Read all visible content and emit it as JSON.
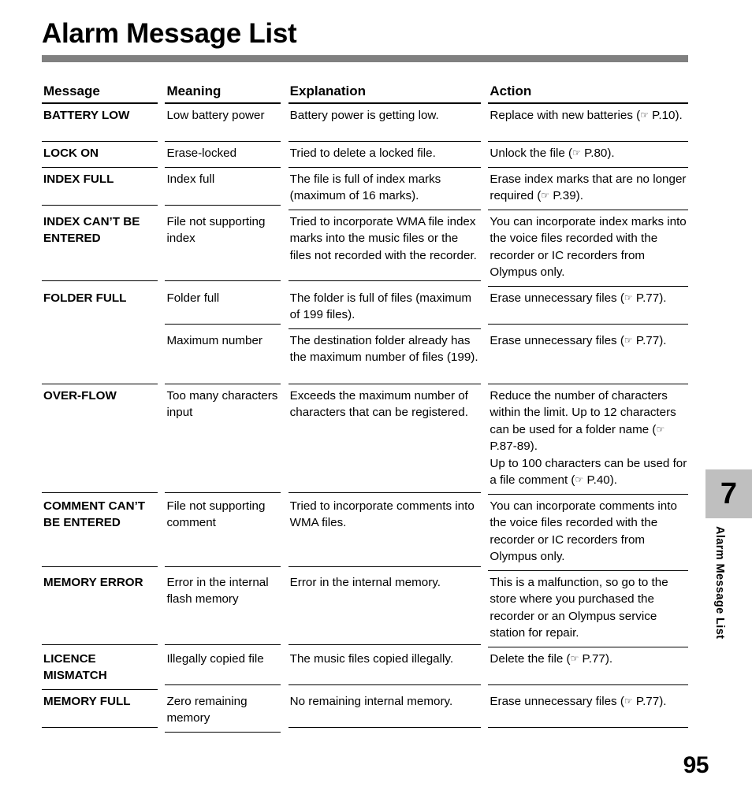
{
  "document": {
    "title": "Alarm Message List",
    "page_number": "95"
  },
  "chapter_tab": {
    "number": "7",
    "label": "Alarm Message List",
    "background_color": "#bfbfbf"
  },
  "table": {
    "headers": {
      "message": "Message",
      "meaning": "Meaning",
      "explanation": "Explanation",
      "action": "Action"
    },
    "ref_icon": "pointing-hand-icon",
    "ref_glyph": "☞",
    "rows": [
      {
        "message": "BATTERY LOW",
        "meaning": "Low battery power",
        "explanation": "Battery power is getting low.",
        "action_parts": [
          {
            "text": "Replace with new batteries ("
          },
          {
            "ref": true
          },
          {
            "text": " P.10)."
          }
        ]
      },
      {
        "message": "LOCK ON",
        "meaning": "Erase-locked",
        "explanation": "Tried to delete a locked file.",
        "action_parts": [
          {
            "text": "Unlock the file ("
          },
          {
            "ref": true
          },
          {
            "text": " P.80)."
          }
        ]
      },
      {
        "message": "INDEX FULL",
        "meaning": "Index full",
        "explanation": "The file is full of index marks (maximum of 16 marks).",
        "action_parts": [
          {
            "text": "Erase index marks that are no longer required ("
          },
          {
            "ref": true
          },
          {
            "text": " P.39)."
          }
        ]
      },
      {
        "message": "INDEX CAN’T BE ENTERED",
        "meaning": "File not supporting index",
        "explanation": "Tried to incorporate WMA file index marks into the music files or the files not recorded with the recorder.",
        "action_parts": [
          {
            "text": "You can incorporate index marks into the voice files recorded with the recorder or IC recorders from Olympus only."
          }
        ]
      },
      {
        "message": "FOLDER FULL",
        "meaning": "Folder full",
        "explanation": "The folder is full of files (maximum of 199 files).",
        "action_parts": [
          {
            "text": "Erase unnecessary files ("
          },
          {
            "ref": true
          },
          {
            "text": " P.77)."
          }
        ]
      },
      {
        "message": "",
        "meaning": "Maximum number",
        "explanation": "The destination folder already has the maximum number of files (199).",
        "action_parts": [
          {
            "text": "Erase unnecessary files ("
          },
          {
            "ref": true
          },
          {
            "text": " P.77)."
          }
        ]
      },
      {
        "message": "OVER-FLOW",
        "meaning": "Too many characters input",
        "explanation": "Exceeds the maximum number of characters that can be registered.",
        "action_parts": [
          {
            "text": "Reduce the number of characters within the limit. Up to 12 characters can be used for a folder name ("
          },
          {
            "ref": true
          },
          {
            "text": " P.87-89)."
          },
          {
            "break": true
          },
          {
            "text": "Up to 100 characters can be used for a file comment ("
          },
          {
            "ref": true
          },
          {
            "text": " P.40)."
          }
        ]
      },
      {
        "message": "COMMENT CAN’T BE ENTERED",
        "meaning": "File not supporting comment",
        "explanation": "Tried to incorporate comments into WMA files.",
        "action_parts": [
          {
            "text": "You can incorporate comments into the voice files recorded with the recorder or IC recorders from Olympus only."
          }
        ]
      },
      {
        "message": "MEMORY ERROR",
        "meaning": "Error in the internal flash memory",
        "explanation": "Error in the internal memory.",
        "action_parts": [
          {
            "text": "This is a malfunction, so go to the store where you purchased the recorder or an Olympus service station for repair."
          }
        ]
      },
      {
        "message": "LICENCE MISMATCH",
        "meaning": "Illegally copied file",
        "explanation": "The music files copied illegally.",
        "action_parts": [
          {
            "text": "Delete the file ("
          },
          {
            "ref": true
          },
          {
            "text": " P.77)."
          }
        ]
      },
      {
        "message": "MEMORY FULL",
        "meaning": "Zero remaining memory",
        "explanation": "No remaining internal memory.",
        "action_parts": [
          {
            "text": "Erase unnecessary files ("
          },
          {
            "ref": true
          },
          {
            "text": " P.77)."
          }
        ]
      }
    ]
  }
}
